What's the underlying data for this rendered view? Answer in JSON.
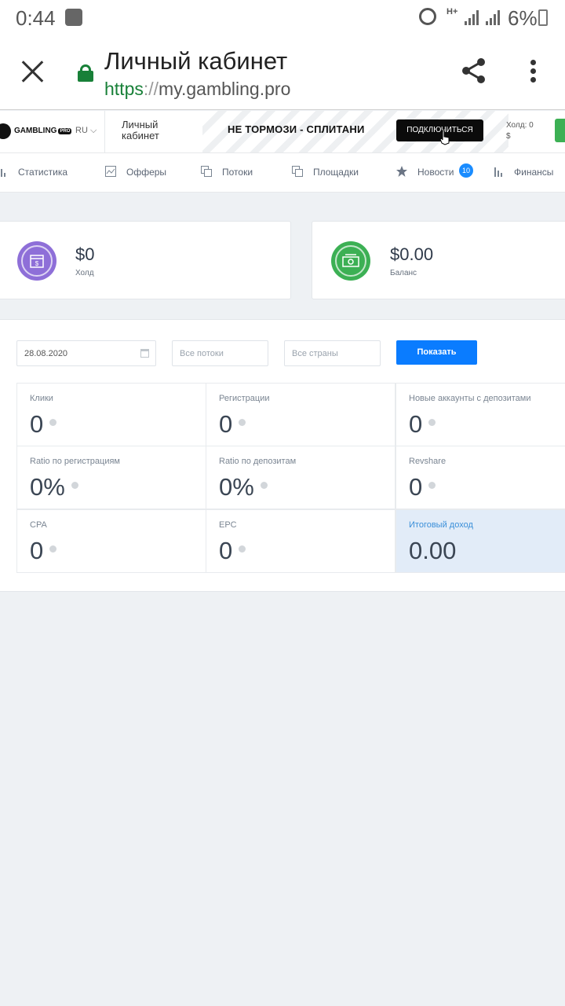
{
  "status_bar": {
    "time": "0:44",
    "network": "H+",
    "battery": "6%"
  },
  "browser": {
    "title": "Личный кабинет",
    "url_scheme": "https",
    "url_sep": "://",
    "url_host": "my.gambling.pro"
  },
  "site_header": {
    "logo": "GAMBLING",
    "logo_pro": "PRO",
    "lang": "RU",
    "title": "Личный кабинет",
    "banner_text": "НЕ ТОРМОЗИ - СПЛИТАНИ",
    "banner_button": "ПОДКЛЮЧИТЬСЯ",
    "hold_label": "Холд: 0",
    "hold_currency": "$"
  },
  "nav": [
    {
      "label": "Статистика",
      "icon": "bar-chart-icon"
    },
    {
      "label": "Офферы",
      "icon": "offers-icon"
    },
    {
      "label": "Потоки",
      "icon": "copy-icon"
    },
    {
      "label": "Площадки",
      "icon": "copy-icon"
    },
    {
      "label": "Новости",
      "icon": "star-icon",
      "badge": "10"
    },
    {
      "label": "Финансы",
      "icon": "bar-chart-icon"
    }
  ],
  "cards": {
    "hold": {
      "value": "$0",
      "label": "Холд",
      "color": "#8e6fd8"
    },
    "balance": {
      "value": "$0.00",
      "label": "Баланс",
      "color": "#3cb054"
    }
  },
  "filters": {
    "date": "28.08.2020",
    "streams_placeholder": "Все потоки",
    "countries_placeholder": "Все страны",
    "show_button": "Показать"
  },
  "stats": [
    {
      "label": "Клики",
      "value": "0"
    },
    {
      "label": "Регистрации",
      "value": "0"
    },
    {
      "label": "Новые аккаунты с депозитами",
      "value": "0"
    },
    {
      "label": "Ratio по регистрациям",
      "value": "0%"
    },
    {
      "label": "Ratio по депозитам",
      "value": "0%"
    },
    {
      "label": "Revshare",
      "value": "0"
    },
    {
      "label": "CPA",
      "value": "0"
    },
    {
      "label": "EPC",
      "value": "0"
    },
    {
      "label": "Итоговый доход",
      "value": "0.00"
    }
  ]
}
